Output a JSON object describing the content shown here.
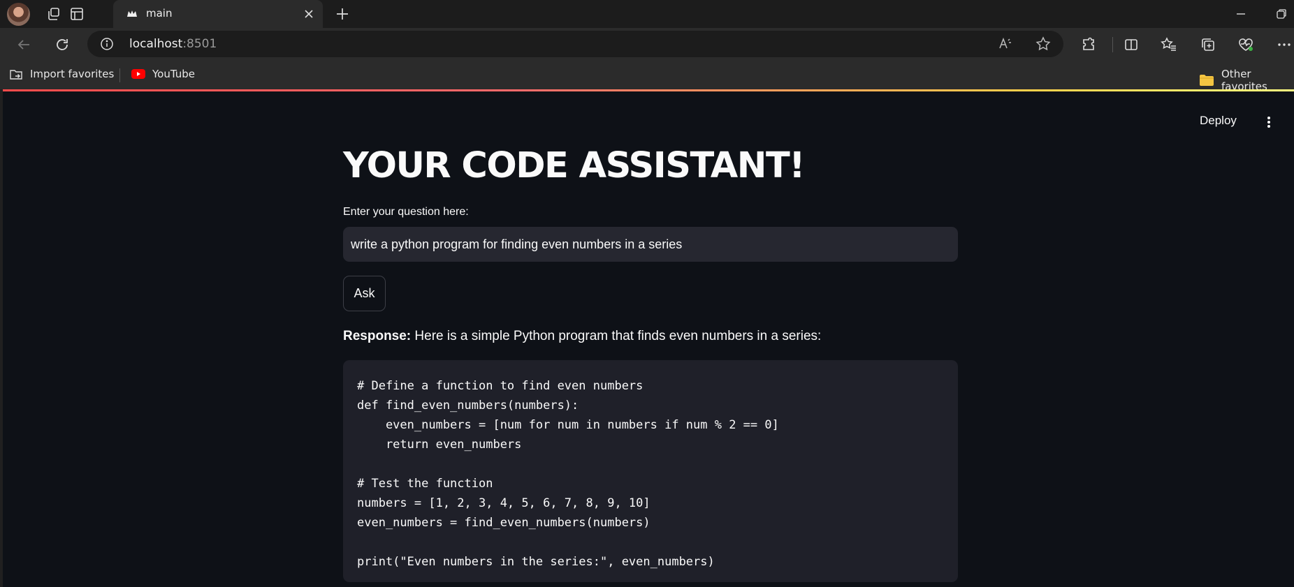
{
  "browser": {
    "tab": {
      "title": "main"
    },
    "address": {
      "host": "localhost",
      "port": ":8501"
    },
    "bookmarks": [
      {
        "label": "Import favorites",
        "icon": "import-favorites-icon"
      },
      {
        "label": "YouTube",
        "icon": "youtube-icon"
      }
    ],
    "other_favorites": "Other favorites"
  },
  "app": {
    "deploy_label": "Deploy",
    "title": "YOUR CODE ASSISTANT!",
    "question_label": "Enter your question here:",
    "question_value": "write a python program for finding even numbers in a series",
    "ask_label": "Ask",
    "response_prefix": "Response:",
    "response_text": " Here is a simple Python program that finds even numbers in a series:",
    "code": "# Define a function to find even numbers\ndef find_even_numbers(numbers):\n    even_numbers = [num for num in numbers if num % 2 == 0]\n    return even_numbers\n\n# Test the function\nnumbers = [1, 2, 3, 4, 5, 6, 7, 8, 9, 10]\neven_numbers = find_even_numbers(numbers)\n\nprint(\"Even numbers in the series:\", even_numbers)"
  },
  "colors": {
    "app_background": "#0e1117",
    "input_background": "#262730",
    "code_background": "#1f2029",
    "accent_red": "#ff4b4b"
  }
}
